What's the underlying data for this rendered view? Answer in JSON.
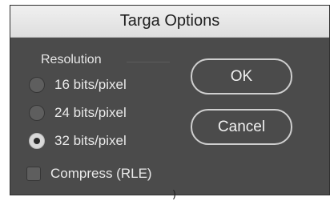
{
  "window": {
    "title": "Targa Options"
  },
  "resolution": {
    "label": "Resolution",
    "options": [
      {
        "label": "16 bits/pixel",
        "selected": false
      },
      {
        "label": "24 bits/pixel",
        "selected": false
      },
      {
        "label": "32 bits/pixel",
        "selected": true
      }
    ]
  },
  "buttons": {
    "ok": "OK",
    "cancel": "Cancel"
  },
  "compress": {
    "label": "Compress (RLE)",
    "checked": false
  },
  "colors": {
    "dialog_bg": "#4b4b4b",
    "titlebar_bg": "#e8e8e8",
    "text": "#e9e9e9"
  }
}
